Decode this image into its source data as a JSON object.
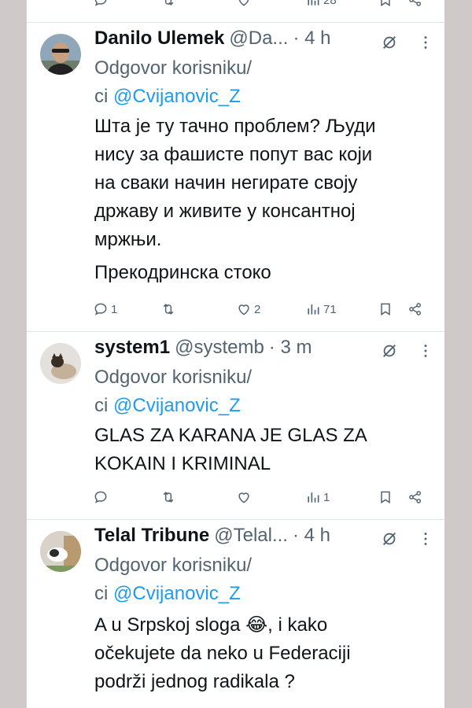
{
  "top_actions": {
    "views": "28"
  },
  "tweets": [
    {
      "name": "Danilo Ulemek",
      "handle": "@Da...",
      "time": "· 4 h",
      "reply_prefix": "Odgovor korisniku/",
      "reply_suffix": "ci",
      "reply_mention": "@Cvijanovic_Z",
      "body": [
        "Шта је ту тачно проблем? Људи",
        "нису за фашисте попут вас који",
        "на сваки начин негирате своју",
        "државу и живите у консантној",
        "мржњи.",
        "Прекодринска стоко"
      ],
      "replies": "1",
      "retweets": "",
      "likes": "2",
      "views": "71"
    },
    {
      "name": "system1",
      "handle": "@systemb",
      "time": "· 3 m",
      "reply_prefix": "Odgovor korisniku/",
      "reply_suffix": "ci",
      "reply_mention": "@Cvijanovic_Z",
      "body": [
        "GLAS ZA KARANA JE GLAS ZA",
        "KOKAIN I KRIMINAL"
      ],
      "replies": "",
      "retweets": "",
      "likes": "",
      "views": "1"
    },
    {
      "name": "Telal Tribune",
      "handle": "@Telal...",
      "time": "· 4 h",
      "reply_prefix": "Odgovor korisniku/",
      "reply_suffix": "ci",
      "reply_mention": "@Cvijanovic_Z",
      "body_line1_a": "A u Srpskoj sloga ",
      "body_emoji": "😂",
      "body_line1_b": ", i kako",
      "body_rest": [
        "očekujete da neko u Federaciji",
        "podrži jednog radikala ?"
      ]
    }
  ],
  "colors": {
    "text": "#0f1419",
    "secondary": "#536471",
    "link": "#1d9bf0",
    "divider": "#e1e6ea",
    "side": "#cfc9ca"
  }
}
